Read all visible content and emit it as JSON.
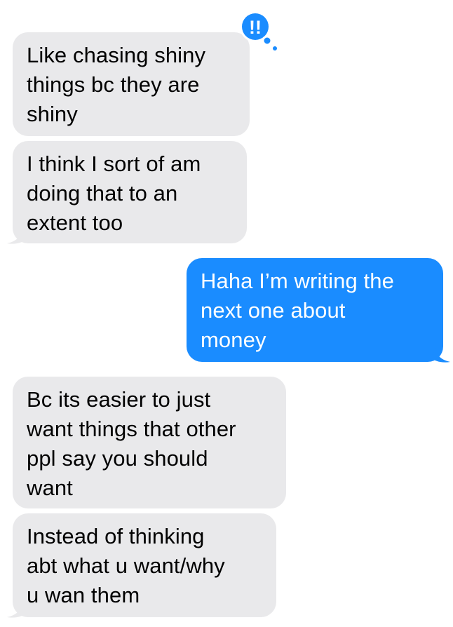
{
  "conversation": {
    "messages": [
      {
        "direction": "incoming",
        "text": "Like chasing shiny\nthings bc they are\nshiny"
      },
      {
        "direction": "incoming",
        "text": "I think I sort of am\ndoing that to an\nextent too"
      },
      {
        "direction": "outgoing",
        "text": "Haha I’m writing the\nnext one about\nmoney"
      },
      {
        "direction": "incoming",
        "text": "Bc its easier to just\nwant things that other\nppl say you should\nwant"
      },
      {
        "direction": "incoming",
        "text": "Instead of thinking\nabt what u want/why\nu wan them"
      }
    ],
    "tapback": {
      "icon": "double-exclamation-icon",
      "glyph": "!!",
      "color": "#1a8cff"
    }
  },
  "colors": {
    "incoming_bubble": "#e9e9eb",
    "outgoing_bubble": "#1a8cff",
    "incoming_text": "#000000",
    "outgoing_text": "#ffffff"
  }
}
